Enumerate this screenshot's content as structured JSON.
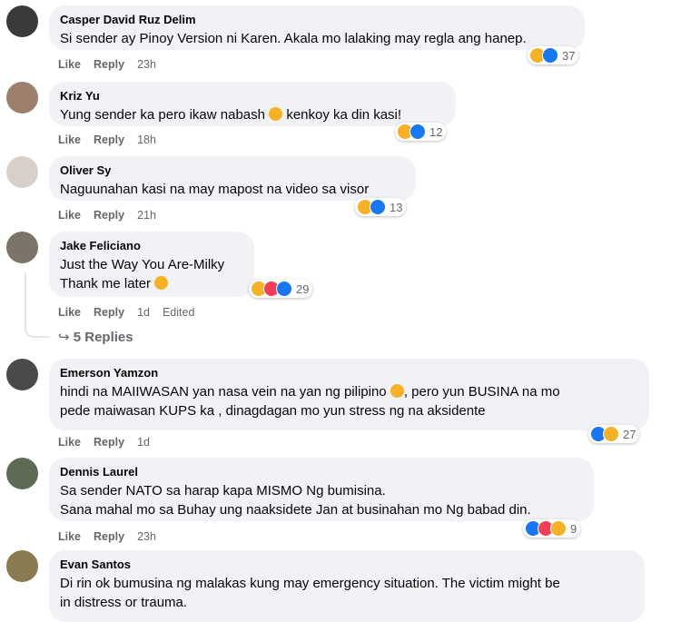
{
  "comments": [
    {
      "author": "Casper David Ruz Delim",
      "lines": [
        "Si sender ay Pinoy Version ni Karen. Akala mo lalaking may regla ang hanep."
      ],
      "like": "Like",
      "reply": "Reply",
      "time": "23h",
      "edited": "",
      "reaction_count": "37",
      "reactions": [
        "haha-icon",
        "like-icon"
      ]
    },
    {
      "author": "Kriz Yu",
      "lines": [
        "Yung sender ka pero ikaw nabash [emoji] kenkoy ka din kasi!"
      ],
      "line_parts": {
        "before": "Yung sender ka pero ikaw nabash ",
        "after": " kenkoy ka din kasi!"
      },
      "like": "Like",
      "reply": "Reply",
      "time": "18h",
      "edited": "",
      "reaction_count": "12",
      "reactions": [
        "haha-icon",
        "like-icon"
      ]
    },
    {
      "author": "Oliver Sy",
      "lines": [
        "Naguunahan kasi na may mapost na video sa visor"
      ],
      "like": "Like",
      "reply": "Reply",
      "time": "21h",
      "edited": "",
      "reaction_count": "13",
      "reactions": [
        "haha-icon",
        "like-icon"
      ]
    },
    {
      "author": "Jake Feliciano",
      "lines": [
        "Just the Way You Are-Milky",
        "Thank me later"
      ],
      "like": "Like",
      "reply": "Reply",
      "time": "1d",
      "edited": "Edited",
      "reaction_count": "29",
      "reactions": [
        "haha-icon",
        "love-icon",
        "like-icon"
      ],
      "replies": "5 Replies"
    },
    {
      "author": "Emerson Yamzon",
      "lines": [
        "hindi na MAIIWASAN yan nasa vein na yan ng pilipino",
        ", pero yun BUSINA na mo",
        "pede maiwasan KUPS ka , dinagdagan mo yun stress ng na aksidente"
      ],
      "like": "Like",
      "reply": "Reply",
      "time": "1d",
      "edited": "",
      "reaction_count": "27",
      "reactions": [
        "like-icon",
        "haha-icon"
      ]
    },
    {
      "author": "Dennis Laurel",
      "lines": [
        "Sa sender NATO sa harap kapa MISMO Ng bumisina.",
        "Sana mahal mo sa Buhay ung naaksidete Jan at businahan mo Ng babad din."
      ],
      "like": "Like",
      "reply": "Reply",
      "time": "23h",
      "edited": "",
      "reaction_count": "9",
      "reactions": [
        "like-icon",
        "love-icon",
        "haha-icon"
      ]
    },
    {
      "author": "Evan Santos",
      "lines": [
        "Di rin ok bumusina ng malakas kung may emergency situation. The victim might be",
        "in distress or trauma."
      ],
      "like": "",
      "reply": "",
      "time": "",
      "edited": "",
      "reaction_count": "",
      "reactions": []
    }
  ],
  "colors": {
    "bubble": "#f0f2f5",
    "meta": "#65676b",
    "like": "#1877f2",
    "haha": "#f7b125",
    "love": "#f33e58"
  }
}
